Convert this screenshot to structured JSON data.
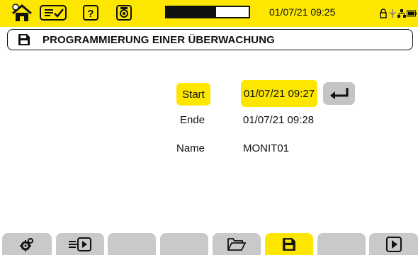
{
  "status": {
    "datetime": "01/07/21 09:25",
    "progress": 0.6,
    "icons": [
      "home-icon",
      "checklist-icon",
      "help-icon",
      "camera-icon",
      "lock-icon",
      "usb-icon",
      "network-icon",
      "battery-icon"
    ]
  },
  "page": {
    "title": "PROGRAMMIERUNG EINER ÜBERWACHUNG",
    "title_icon": "save-icon"
  },
  "form": {
    "start_label": "Start",
    "start_value": "01/07/21 09:27",
    "end_label": "Ende",
    "end_value": "01/07/21 09:28",
    "name_label": "Name",
    "name_value": "MONIT01",
    "enter_icon": "enter-icon"
  },
  "tabs": [
    {
      "icon": "settings-icon",
      "active": false
    },
    {
      "icon": "import-icon",
      "active": false
    },
    {
      "icon": "",
      "active": false
    },
    {
      "icon": "",
      "active": false
    },
    {
      "icon": "folder-icon",
      "active": false
    },
    {
      "icon": "save-icon",
      "active": true
    },
    {
      "icon": "",
      "active": false
    },
    {
      "icon": "play-icon",
      "active": false
    }
  ],
  "colors": {
    "accent": "#fde600",
    "tab": "#c9c9c9",
    "button": "#c4c4c4"
  }
}
